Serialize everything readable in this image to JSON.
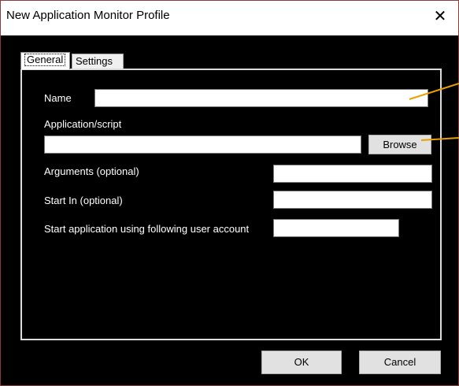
{
  "window": {
    "title": "New Application Monitor Profile",
    "close_label": "✕"
  },
  "tabs": [
    {
      "label": "General",
      "selected": true
    },
    {
      "label": "Settings",
      "selected": false
    }
  ],
  "form": {
    "name_label": "Name",
    "name_value": "",
    "app_label": "Application/script",
    "app_value": "",
    "browse_label": "Browse",
    "args_label": "Arguments (optional)",
    "args_value": "",
    "startin_label": "Start In (optional)",
    "startin_value": "",
    "account_label": "Start application using following user account",
    "account_value": ""
  },
  "buttons": {
    "ok_label": "OK",
    "cancel_label": "Cancel"
  },
  "colors": {
    "callout": "#e8a000",
    "background": "#000000",
    "field": "#ffffff"
  },
  "icons": {
    "close": "close-icon"
  }
}
